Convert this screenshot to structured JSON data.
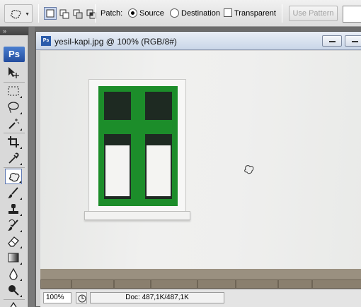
{
  "options_bar": {
    "tool_preset_icon": "patch-tool-icon",
    "selection_modes": [
      "new-selection",
      "add-to-selection",
      "subtract-from-selection",
      "intersect-with-selection"
    ],
    "active_mode_index": 0,
    "patch_label": "Patch:",
    "source_label": "Source",
    "destination_label": "Destination",
    "transparent_label": "Transparent",
    "patch_value": "Source",
    "transparent_checked": false,
    "use_pattern_label": "Use Pattern"
  },
  "toolbox": {
    "grip": "»",
    "logo": "Ps",
    "tools": [
      "move",
      "marquee",
      "lasso",
      "magic-wand",
      "crop",
      "eyedropper",
      "patch",
      "brush",
      "clone-stamp",
      "history-brush",
      "eraser",
      "gradient",
      "blur",
      "dodge",
      "pen"
    ],
    "active_tool": "patch"
  },
  "document": {
    "title": "yesil-kapi.jpg @ 100% (RGB/8#)",
    "zoom": "100%",
    "doc_info": "Doc: 487,1K/487,1K",
    "colors": {
      "window_green": "#1c8d2a",
      "wall": "#eeeeed",
      "stone": "#9a9080"
    }
  }
}
